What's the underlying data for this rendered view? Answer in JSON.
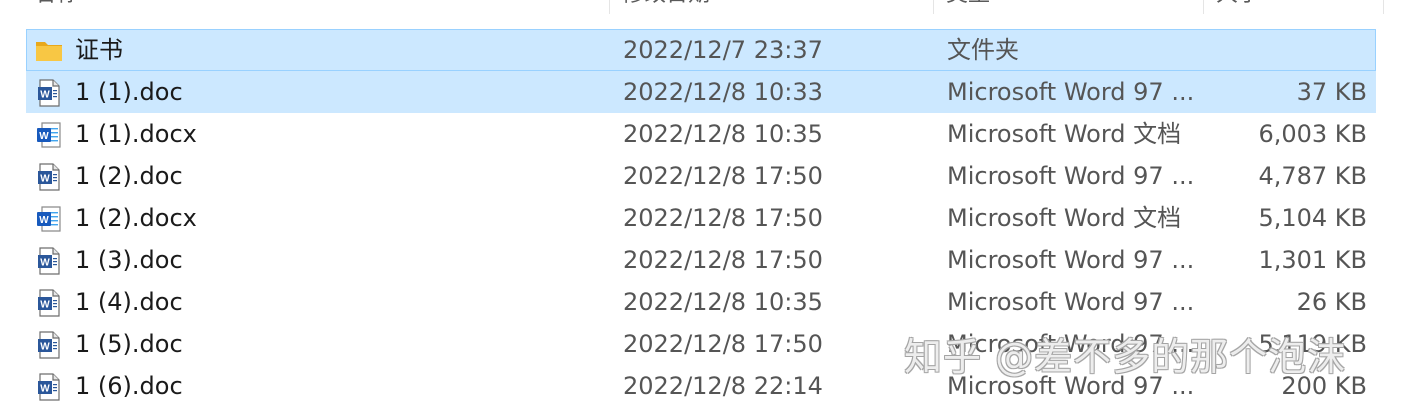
{
  "header": {
    "col_name": "名称",
    "col_date": "修改日期",
    "col_type": "类型",
    "col_size": "大小"
  },
  "files": [
    {
      "icon": "folder-icon",
      "name": "证书",
      "date": "2022/12/7 23:37",
      "type": "文件夹",
      "size": "",
      "state": "selected"
    },
    {
      "icon": "word-doc-icon",
      "name": "1 (1).doc",
      "date": "2022/12/8 10:33",
      "type": "Microsoft Word 97 ...",
      "size": "37 KB",
      "state": "hover"
    },
    {
      "icon": "word-docx-icon",
      "name": "1 (1).docx",
      "date": "2022/12/8 10:35",
      "type": "Microsoft Word 文档",
      "size": "6,003 KB",
      "state": ""
    },
    {
      "icon": "word-doc-icon",
      "name": "1 (2).doc",
      "date": "2022/12/8 17:50",
      "type": "Microsoft Word 97 ...",
      "size": "4,787 KB",
      "state": ""
    },
    {
      "icon": "word-docx-icon",
      "name": "1 (2).docx",
      "date": "2022/12/8 17:50",
      "type": "Microsoft Word 文档",
      "size": "5,104 KB",
      "state": ""
    },
    {
      "icon": "word-doc-icon",
      "name": "1 (3).doc",
      "date": "2022/12/8 17:50",
      "type": "Microsoft Word 97 ...",
      "size": "1,301 KB",
      "state": ""
    },
    {
      "icon": "word-doc-icon",
      "name": "1 (4).doc",
      "date": "2022/12/8 10:35",
      "type": "Microsoft Word 97 ...",
      "size": "26 KB",
      "state": ""
    },
    {
      "icon": "word-doc-icon",
      "name": "1 (5).doc",
      "date": "2022/12/8 17:50",
      "type": "Microsoft Word 97 ...",
      "size": "5,119 KB",
      "state": ""
    },
    {
      "icon": "word-doc-icon",
      "name": "1 (6).doc",
      "date": "2022/12/8 22:14",
      "type": "Microsoft Word 97 ...",
      "size": "200 KB",
      "state": ""
    }
  ],
  "watermark": "知乎 @差不多的那个泡沫",
  "colors": {
    "selection_bg": "#cce8ff",
    "selection_border": "#99d1ff",
    "folder": "#f8c744",
    "word_blue": "#2b579a"
  }
}
